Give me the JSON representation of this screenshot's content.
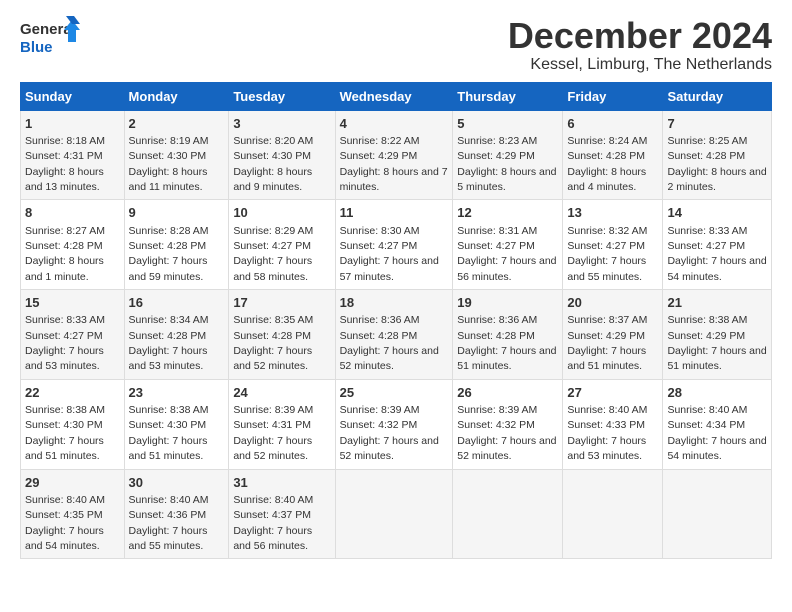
{
  "logo": {
    "line1": "General",
    "line2": "Blue"
  },
  "title": "December 2024",
  "subtitle": "Kessel, Limburg, The Netherlands",
  "days_header": [
    "Sunday",
    "Monday",
    "Tuesday",
    "Wednesday",
    "Thursday",
    "Friday",
    "Saturday"
  ],
  "weeks": [
    [
      {
        "day": "1",
        "sunrise": "8:18 AM",
        "sunset": "4:31 PM",
        "daylight": "8 hours and 13 minutes."
      },
      {
        "day": "2",
        "sunrise": "8:19 AM",
        "sunset": "4:30 PM",
        "daylight": "8 hours and 11 minutes."
      },
      {
        "day": "3",
        "sunrise": "8:20 AM",
        "sunset": "4:30 PM",
        "daylight": "8 hours and 9 minutes."
      },
      {
        "day": "4",
        "sunrise": "8:22 AM",
        "sunset": "4:29 PM",
        "daylight": "8 hours and 7 minutes."
      },
      {
        "day": "5",
        "sunrise": "8:23 AM",
        "sunset": "4:29 PM",
        "daylight": "8 hours and 5 minutes."
      },
      {
        "day": "6",
        "sunrise": "8:24 AM",
        "sunset": "4:28 PM",
        "daylight": "8 hours and 4 minutes."
      },
      {
        "day": "7",
        "sunrise": "8:25 AM",
        "sunset": "4:28 PM",
        "daylight": "8 hours and 2 minutes."
      }
    ],
    [
      {
        "day": "8",
        "sunrise": "8:27 AM",
        "sunset": "4:28 PM",
        "daylight": "8 hours and 1 minute."
      },
      {
        "day": "9",
        "sunrise": "8:28 AM",
        "sunset": "4:28 PM",
        "daylight": "7 hours and 59 minutes."
      },
      {
        "day": "10",
        "sunrise": "8:29 AM",
        "sunset": "4:27 PM",
        "daylight": "7 hours and 58 minutes."
      },
      {
        "day": "11",
        "sunrise": "8:30 AM",
        "sunset": "4:27 PM",
        "daylight": "7 hours and 57 minutes."
      },
      {
        "day": "12",
        "sunrise": "8:31 AM",
        "sunset": "4:27 PM",
        "daylight": "7 hours and 56 minutes."
      },
      {
        "day": "13",
        "sunrise": "8:32 AM",
        "sunset": "4:27 PM",
        "daylight": "7 hours and 55 minutes."
      },
      {
        "day": "14",
        "sunrise": "8:33 AM",
        "sunset": "4:27 PM",
        "daylight": "7 hours and 54 minutes."
      }
    ],
    [
      {
        "day": "15",
        "sunrise": "8:33 AM",
        "sunset": "4:27 PM",
        "daylight": "7 hours and 53 minutes."
      },
      {
        "day": "16",
        "sunrise": "8:34 AM",
        "sunset": "4:28 PM",
        "daylight": "7 hours and 53 minutes."
      },
      {
        "day": "17",
        "sunrise": "8:35 AM",
        "sunset": "4:28 PM",
        "daylight": "7 hours and 52 minutes."
      },
      {
        "day": "18",
        "sunrise": "8:36 AM",
        "sunset": "4:28 PM",
        "daylight": "7 hours and 52 minutes."
      },
      {
        "day": "19",
        "sunrise": "8:36 AM",
        "sunset": "4:28 PM",
        "daylight": "7 hours and 51 minutes."
      },
      {
        "day": "20",
        "sunrise": "8:37 AM",
        "sunset": "4:29 PM",
        "daylight": "7 hours and 51 minutes."
      },
      {
        "day": "21",
        "sunrise": "8:38 AM",
        "sunset": "4:29 PM",
        "daylight": "7 hours and 51 minutes."
      }
    ],
    [
      {
        "day": "22",
        "sunrise": "8:38 AM",
        "sunset": "4:30 PM",
        "daylight": "7 hours and 51 minutes."
      },
      {
        "day": "23",
        "sunrise": "8:38 AM",
        "sunset": "4:30 PM",
        "daylight": "7 hours and 51 minutes."
      },
      {
        "day": "24",
        "sunrise": "8:39 AM",
        "sunset": "4:31 PM",
        "daylight": "7 hours and 52 minutes."
      },
      {
        "day": "25",
        "sunrise": "8:39 AM",
        "sunset": "4:32 PM",
        "daylight": "7 hours and 52 minutes."
      },
      {
        "day": "26",
        "sunrise": "8:39 AM",
        "sunset": "4:32 PM",
        "daylight": "7 hours and 52 minutes."
      },
      {
        "day": "27",
        "sunrise": "8:40 AM",
        "sunset": "4:33 PM",
        "daylight": "7 hours and 53 minutes."
      },
      {
        "day": "28",
        "sunrise": "8:40 AM",
        "sunset": "4:34 PM",
        "daylight": "7 hours and 54 minutes."
      }
    ],
    [
      {
        "day": "29",
        "sunrise": "8:40 AM",
        "sunset": "4:35 PM",
        "daylight": "7 hours and 54 minutes."
      },
      {
        "day": "30",
        "sunrise": "8:40 AM",
        "sunset": "4:36 PM",
        "daylight": "7 hours and 55 minutes."
      },
      {
        "day": "31",
        "sunrise": "8:40 AM",
        "sunset": "4:37 PM",
        "daylight": "7 hours and 56 minutes."
      },
      null,
      null,
      null,
      null
    ]
  ]
}
